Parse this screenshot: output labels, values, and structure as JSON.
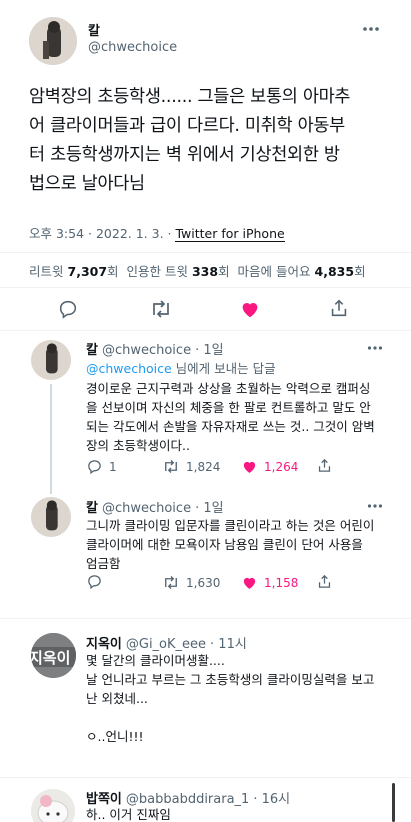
{
  "main_tweet": {
    "name": "칼",
    "handle": "@chwechoice",
    "text_lines": [
      "암벽장의 초등학생...... 그들은 보통의 아마추",
      "어 클라이머들과 급이 다르다. 미취학 아동부",
      "터 초등학생까지는 벽 위에서 기상천외한 방",
      "법으로 날아다님"
    ],
    "timestamp": "오후 3:54 · 2022. 1. 3. · ",
    "source": "Twitter for iPhone",
    "stats": {
      "retweet_label": "리트윗",
      "retweet_count": "7,307",
      "retweet_unit": "회",
      "quote_label": "인용한 트윗",
      "quote_count": "338",
      "quote_unit": "회",
      "like_label": "마음에 들어요",
      "like_count": "4,835",
      "like_unit": "회"
    }
  },
  "replies": [
    {
      "name": "칼",
      "handle": "@chwechoice",
      "time": "· 1일",
      "reply_to_mention": "@chwechoice",
      "reply_to_suffix": " 님에게 보내는 답글",
      "text_lines": [
        "경이로운 근지구력과 상상을 초월하는 악력으로 캠퍼싱",
        "을 선보이며 자신의 체중을 한 팔로 컨트롤하고 말도 안",
        "되는 각도에서 손발을 자유자재로 쓰는 것.. 그것이 암벽",
        "장의 초등학생이다.."
      ],
      "reply_count": "1",
      "retweet_count": "1,824",
      "like_count": "1,264"
    },
    {
      "name": "칼",
      "handle": "@chwechoice",
      "time": "· 1일",
      "text_lines": [
        "그니까 클라이밍 입문자를 클린이라고 하는 것은 어린이",
        "클라이머에 대한 모욕이자 남용임 클린이 단어 사용을",
        "엄금함"
      ],
      "retweet_count": "1,630",
      "like_count": "1,158"
    },
    {
      "name": "지옥이",
      "handle": "@Gi_oK_eee",
      "time": "· 11시",
      "text_lines": [
        "몇 달간의 클라이머생활....",
        "날 언니라고 부르는 그 초등학생의 클라이밍실력을 보고",
        "난 외쳤네...",
        "",
        "ㅇ..언니!!!"
      ]
    },
    {
      "name": "밥쪽이",
      "handle": "@babbabddirara_1",
      "time": "· 16시",
      "text_lines": [
        "하.. 이거 진짜임"
      ]
    }
  ],
  "avatar3_text": "지옥이",
  "colors": {
    "like": "#f91880",
    "link": "#1d9bf0",
    "gray": "#536471"
  }
}
